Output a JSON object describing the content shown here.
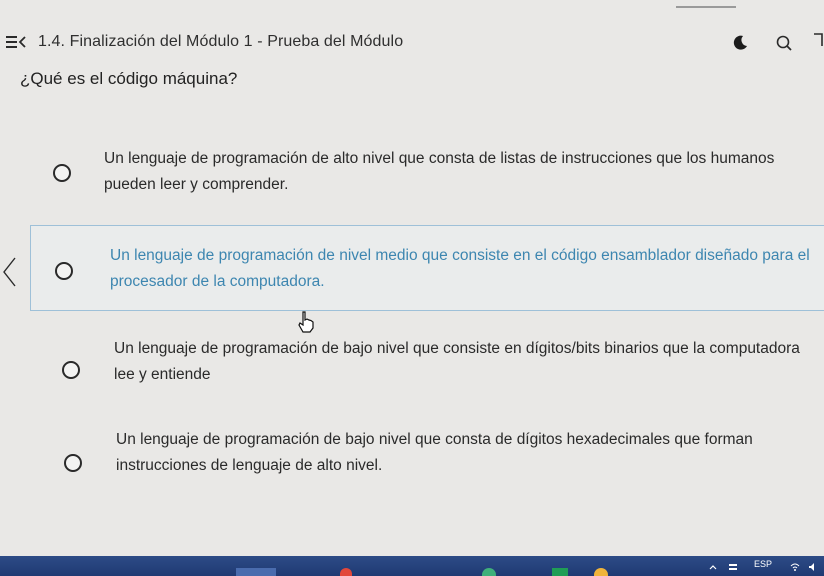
{
  "header": {
    "title": "1.4. Finalización del Módulo 1 - Prueba del Módulo"
  },
  "question": {
    "text": "¿Qué es el código máquina?"
  },
  "options": [
    {
      "text": "Un lenguaje de programación de alto nivel que consta de listas de instrucciones que los humanos pueden leer y comprender."
    },
    {
      "text": "Un lenguaje de programación de nivel medio que consiste en el código ensamblador diseñado para el procesador de la computadora."
    },
    {
      "text": "Un lenguaje de programación de bajo nivel que consiste en dígitos/bits binarios que la computadora lee y entiende"
    },
    {
      "text": "Un lenguaje de programación de bajo nivel que consta de dígitos hexadecimales que forman instrucciones de lenguaje de alto nivel."
    }
  ],
  "taskbar": {
    "language": "ESP"
  },
  "icons": {
    "menu": "menu-collapse-icon",
    "theme": "dark-mode-moon-icon",
    "search": "search-icon",
    "previous": "chevron-left-icon",
    "cursor": "hand-pointer-icon"
  },
  "colors": {
    "highlight_text": "#3d86b0",
    "highlight_border": "#9ec0d8",
    "taskbar": "#24407a"
  }
}
